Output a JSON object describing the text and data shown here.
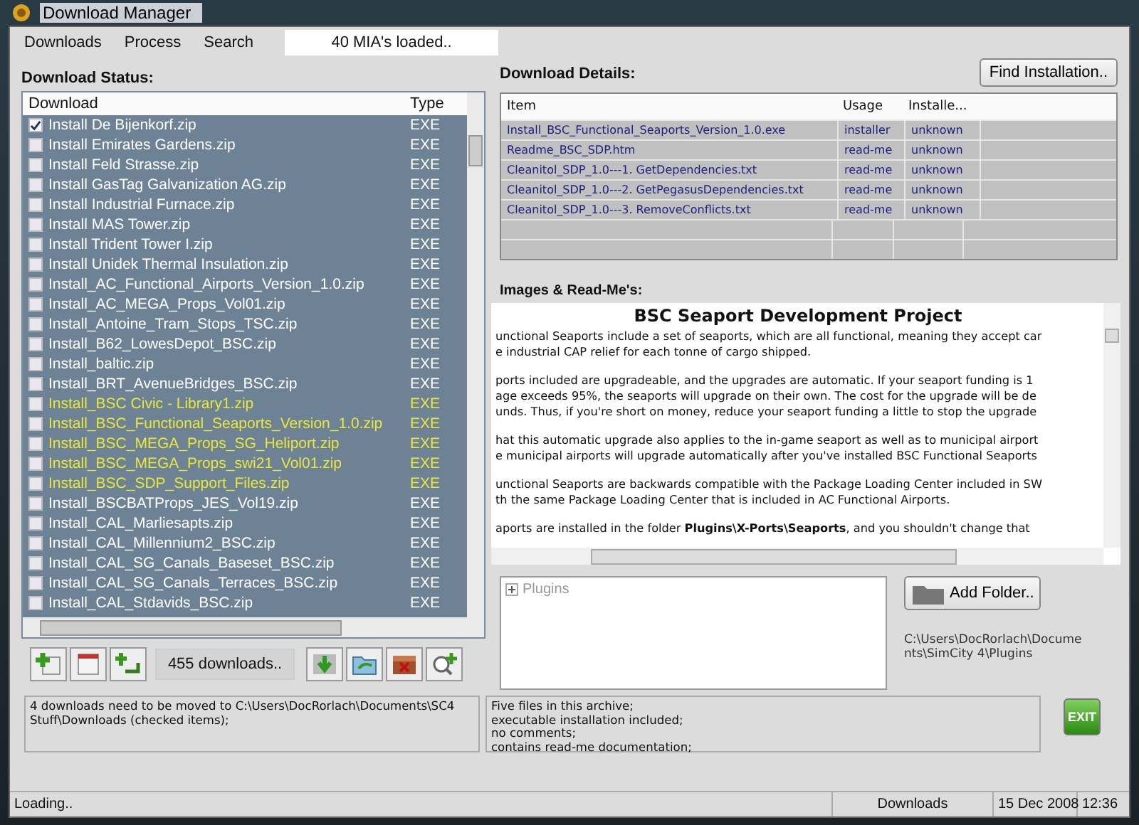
{
  "window": {
    "title": "Download Manager"
  },
  "menu": [
    "Downloads",
    "Process",
    "Search"
  ],
  "menu_status": "40 MIA's loaded..",
  "download_status": {
    "label": "Download Status:",
    "columns": [
      "Download",
      "Type"
    ],
    "rows": [
      {
        "name": "Install De Bijenkorf.zip",
        "type": "EXE",
        "checked": true,
        "color": "#ffffff"
      },
      {
        "name": "Install Emirates Gardens.zip",
        "type": "EXE",
        "checked": false,
        "color": "#ffffff"
      },
      {
        "name": "Install Feld Strasse.zip",
        "type": "EXE",
        "checked": false,
        "color": "#ffffff"
      },
      {
        "name": "Install GasTag Galvanization AG.zip",
        "type": "EXE",
        "checked": false,
        "color": "#ffffff"
      },
      {
        "name": "Install Industrial Furnace.zip",
        "type": "EXE",
        "checked": false,
        "color": "#ffffff"
      },
      {
        "name": "Install MAS Tower.zip",
        "type": "EXE",
        "checked": false,
        "color": "#ffffff"
      },
      {
        "name": "Install Trident Tower I.zip",
        "type": "EXE",
        "checked": false,
        "color": "#ffffff"
      },
      {
        "name": "Install Unidek Thermal Insulation.zip",
        "type": "EXE",
        "checked": false,
        "color": "#ffffff"
      },
      {
        "name": "Install_AC_Functional_Airports_Version_1.0.zip",
        "type": "EXE",
        "checked": false,
        "color": "#ffffff"
      },
      {
        "name": "Install_AC_MEGA_Props_Vol01.zip",
        "type": "EXE",
        "checked": false,
        "color": "#ffffff"
      },
      {
        "name": "Install_Antoine_Tram_Stops_TSC.zip",
        "type": "EXE",
        "checked": false,
        "color": "#ffffff"
      },
      {
        "name": "Install_B62_LowesDepot_BSC.zip",
        "type": "EXE",
        "checked": false,
        "color": "#ffffff"
      },
      {
        "name": "Install_baltic.zip",
        "type": "EXE",
        "checked": false,
        "color": "#ffffff"
      },
      {
        "name": "Install_BRT_AvenueBridges_BSC.zip",
        "type": "EXE",
        "checked": false,
        "color": "#ffffff"
      },
      {
        "name": "Install_BSC Civic - Library1.zip",
        "type": "EXE",
        "checked": false,
        "color": "#e8e83a"
      },
      {
        "name": "Install_BSC_Functional_Seaports_Version_1.0.zip",
        "type": "EXE",
        "checked": false,
        "color": "#e8e83a"
      },
      {
        "name": "Install_BSC_MEGA_Props_SG_Heliport.zip",
        "type": "EXE",
        "checked": false,
        "color": "#e8e83a"
      },
      {
        "name": "Install_BSC_MEGA_Props_swi21_Vol01.zip",
        "type": "EXE",
        "checked": false,
        "color": "#e8e83a"
      },
      {
        "name": "Install_BSC_SDP_Support_Files.zip",
        "type": "EXE",
        "checked": false,
        "color": "#e8e83a"
      },
      {
        "name": "Install_BSCBATProps_JES_Vol19.zip",
        "type": "EXE",
        "checked": false,
        "color": "#ffffff"
      },
      {
        "name": "Install_CAL_Marliesapts.zip",
        "type": "EXE",
        "checked": false,
        "color": "#ffffff"
      },
      {
        "name": "Install_CAL_Millennium2_BSC.zip",
        "type": "EXE",
        "checked": false,
        "color": "#ffffff"
      },
      {
        "name": "Install_CAL_SG_Canals_Baseset_BSC.zip",
        "type": "EXE",
        "checked": false,
        "color": "#ffffff"
      },
      {
        "name": "Install_CAL_SG_Canals_Terraces_BSC.zip",
        "type": "EXE",
        "checked": false,
        "color": "#ffffff"
      },
      {
        "name": "Install_CAL_Stdavids_BSC.zip",
        "type": "EXE",
        "checked": false,
        "color": "#ffffff"
      }
    ]
  },
  "toolbar_count": "455 downloads..",
  "download_details": {
    "label": "Download Details:",
    "find_button": "Find Installation..",
    "columns": [
      "Item",
      "Usage",
      "Installe..."
    ],
    "rows": [
      {
        "item": "Install_BSC_Functional_Seaports_Version_1.0.exe",
        "usage": "installer",
        "installed": "unknown"
      },
      {
        "item": "Readme_BSC_SDP.htm",
        "usage": "read-me",
        "installed": "unknown"
      },
      {
        "item": "Cleanitol_SDP_1.0---1. GetDependencies.txt",
        "usage": "read-me",
        "installed": "unknown"
      },
      {
        "item": "Cleanitol_SDP_1.0---2. GetPegasusDependencies.txt",
        "usage": "read-me",
        "installed": "unknown"
      },
      {
        "item": "Cleanitol_SDP_1.0---3. RemoveConflicts.txt",
        "usage": "read-me",
        "installed": "unknown"
      }
    ]
  },
  "readme": {
    "label": "Images & Read-Me's:",
    "title": "BSC Seaport Development Project",
    "paragraphs": [
      [
        "unctional Seaports include a set of seaports, which are all functional, meaning they accept car",
        "e industrial CAP relief for each tonne of cargo shipped."
      ],
      [
        "ports included are upgradeable, and the upgrades are automatic. If your seaport funding is 1",
        "age exceeds 95%, the seaports will upgrade on their own. The cost for the upgrade will be de",
        "unds. Thus, if you're short on money, reduce your seaport funding a little to stop the upgrade"
      ],
      [
        "hat this automatic upgrade also applies to the in-game seaport as well as to municipal airport",
        "e municipal airports will upgrade automatically after you've installed BSC Functional Seaports"
      ],
      [
        "unctional Seaports are backwards compatible with the Package Loading Center included in SW",
        "th the same Package Loading Center that is included in AC Functional Airports."
      ],
      [
        "aports are installed in the folder **Plugins\\X-Ports\\Seaports**, and you shouldn't change that"
      ]
    ]
  },
  "folders": {
    "tree": [
      {
        "label": "Plugins",
        "expanded": false
      }
    ],
    "add_button": "Add Folder..",
    "path": "C:\\Users\\DocRorlach\\Documents\\SimCity 4\\Plugins"
  },
  "messages": {
    "left": "4 downloads need to be moved to C:\\Users\\DocRorlach\\Documents\\SC4 Stuff\\Downloads (checked items);",
    "right": [
      "Five files in this archive;",
      "executable installation included;",
      "no comments;",
      "contains read-me documentation;"
    ]
  },
  "exit_button": "EXIT",
  "status_bar": {
    "left": "Loading..",
    "section": "Downloads",
    "date": "15 Dec 2008",
    "time": "12:36"
  }
}
